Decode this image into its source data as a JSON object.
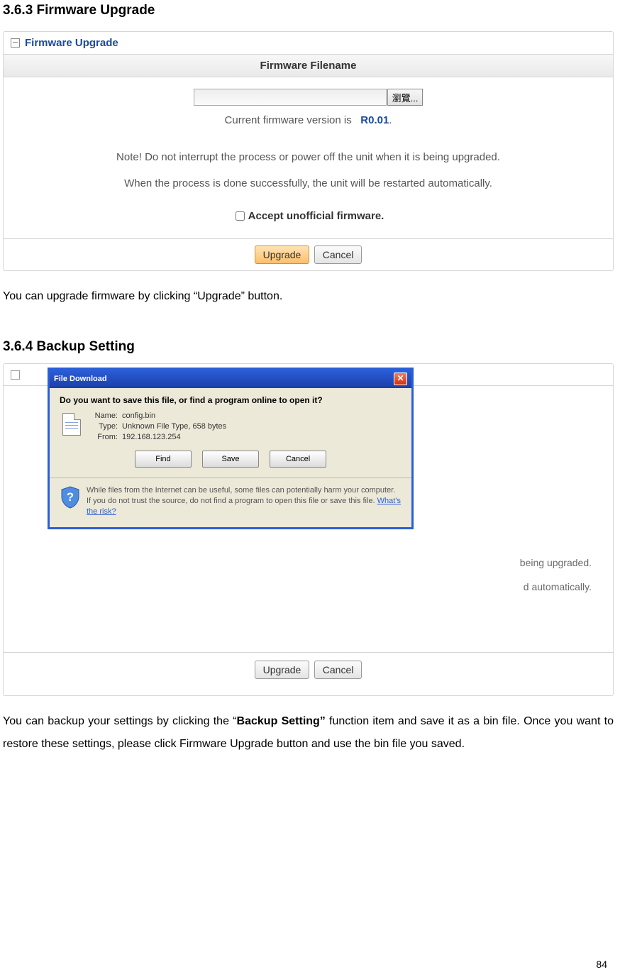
{
  "headings": {
    "h363": "3.6.3 Firmware Upgrade",
    "h364": "3.6.4 Backup Setting"
  },
  "panel1": {
    "title": "Firmware Upgrade",
    "section_header": "Firmware Filename",
    "browse_label": "瀏覽...",
    "version_prefix": "Current firmware version is",
    "version_value": "R0.01",
    "version_suffix": ".",
    "note": "Note! Do not interrupt the process or power off the unit when it is being upgraded.",
    "restart": "When the process is done successfully, the unit will be restarted automatically.",
    "accept_label": "Accept unofficial firmware.",
    "upgrade_btn": "Upgrade",
    "cancel_btn": "Cancel"
  },
  "paragraphs": {
    "p1": "You can upgrade firmware by clicking “Upgrade” button.",
    "p2a": "You can backup your settings by clicking the “",
    "p2b": "Backup Setting”",
    "p2c": " function item and save it as a bin file. Once you want to restore these settings, please click Firmware Upgrade button and use the bin file you saved."
  },
  "panel2": {
    "behind1": "being upgraded.",
    "behind2": "d automatically."
  },
  "dialog": {
    "title": "File Download",
    "question": "Do you want to save this file, or find a program online to open it?",
    "name_lbl": "Name:",
    "name_val": "config.bin",
    "type_lbl": "Type:",
    "type_val": "Unknown File Type, 658 bytes",
    "from_lbl": "From:",
    "from_val": "192.168.123.254",
    "find": "Find",
    "save": "Save",
    "cancel": "Cancel",
    "warning": "While files from the Internet can be useful, some files can potentially harm your computer. If you do not trust the source, do not find a program to open this file or save this file. ",
    "risk_link": "What's the risk?"
  },
  "page_number": "84"
}
